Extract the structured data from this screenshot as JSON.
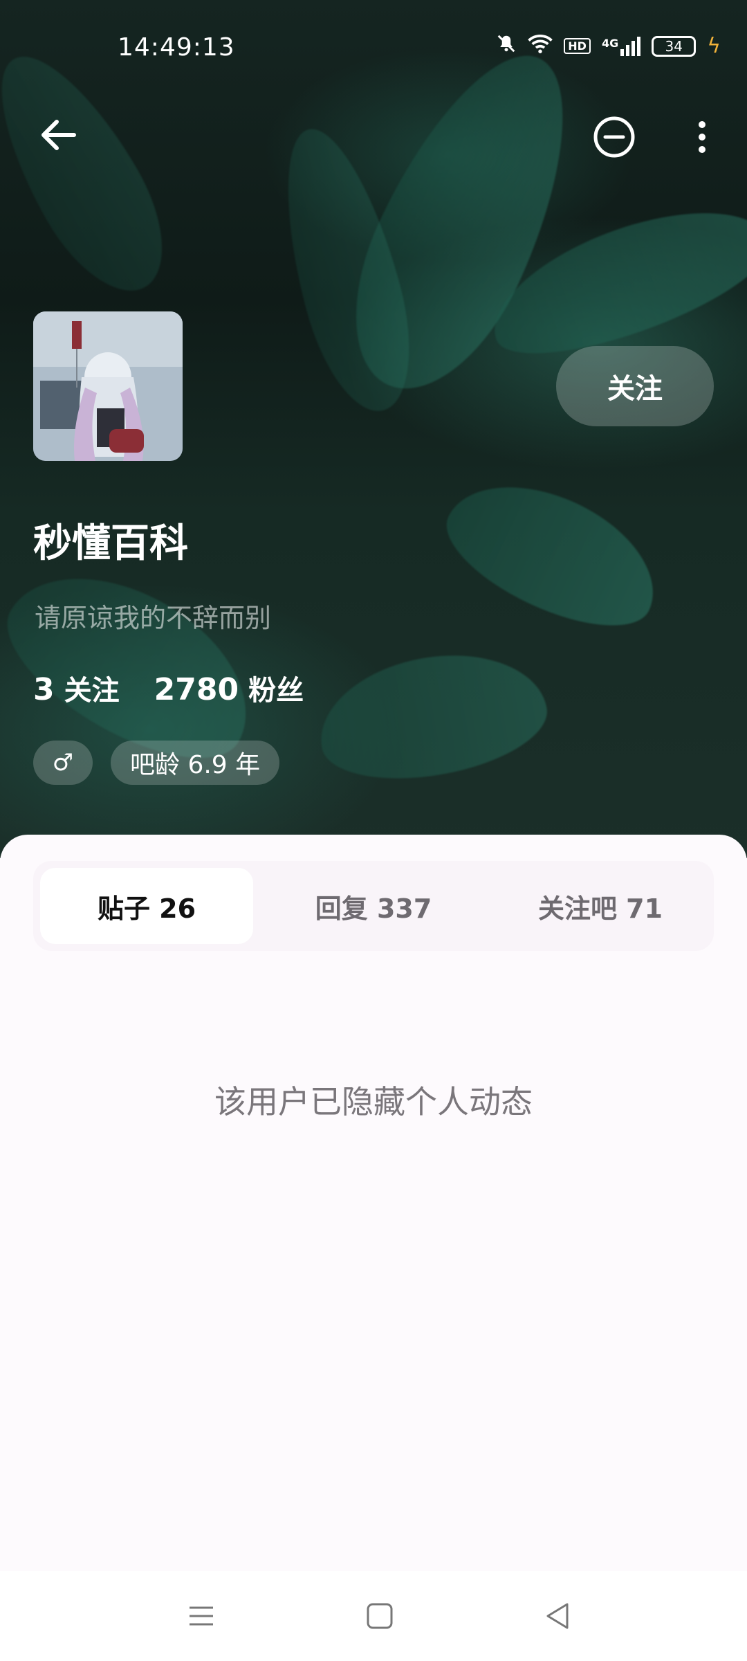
{
  "status_bar": {
    "time": "14:49:13",
    "battery": "34",
    "hd_label": "HD",
    "network_label": "4G",
    "icons": [
      "mute-icon",
      "wifi-icon",
      "hd-icon",
      "signal-icon",
      "battery-icon",
      "charging-icon"
    ]
  },
  "nav": {
    "back_icon": "arrow-left-icon",
    "block_icon": "minus-circle-icon",
    "more_icon": "more-vertical-icon"
  },
  "profile": {
    "follow_label": "关注",
    "username": "秒懂百科",
    "bio": "请原谅我的不辞而别",
    "following_count": "3",
    "following_label": "关注",
    "followers_count": "2780",
    "followers_label": "粉丝",
    "gender_symbol": "♂",
    "age_tag": "吧龄 6.9 年"
  },
  "tabs": [
    {
      "label": "贴子 26",
      "active": true
    },
    {
      "label": "回复 337",
      "active": false
    },
    {
      "label": "关注吧 71",
      "active": false
    }
  ],
  "empty_message": "该用户已隐藏个人动态",
  "system_nav": {
    "menu_icon": "menu-icon",
    "home_icon": "home-square-icon",
    "back_icon": "back-triangle-icon"
  },
  "colors": {
    "header_dark": "#152521",
    "accent_green": "#2e826e",
    "panel_bg": "#fdfafd",
    "charging": "#f2b33a"
  }
}
